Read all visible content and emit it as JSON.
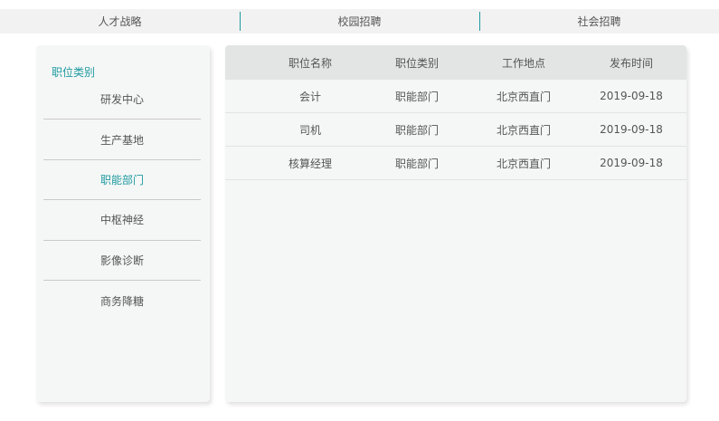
{
  "top_tabs": [
    {
      "label": "人才战略"
    },
    {
      "label": "校园招聘"
    },
    {
      "label": "社会招聘"
    }
  ],
  "sidebar": {
    "title": "职位类别",
    "items": [
      {
        "label": "研发中心"
      },
      {
        "label": "生产基地"
      },
      {
        "label": "职能部门"
      },
      {
        "label": "中枢神经"
      },
      {
        "label": "影像诊断"
      },
      {
        "label": "商务降糖"
      }
    ],
    "active_index": 2
  },
  "table": {
    "headers": [
      "职位名称",
      "职位类别",
      "工作地点",
      "发布时间"
    ],
    "rows": [
      [
        "会计",
        "职能部门",
        "北京西直门",
        "2019-09-18"
      ],
      [
        "司机",
        "职能部门",
        "北京西直门",
        "2019-09-18"
      ],
      [
        "核算经理",
        "职能部门",
        "北京西直门",
        "2019-09-18"
      ]
    ]
  },
  "colors": {
    "accent": "#1e9aa0",
    "panel_bg": "#f5f7f6",
    "header_bg": "#e3e5e4",
    "tabbar_bg": "#f2f2f2"
  }
}
